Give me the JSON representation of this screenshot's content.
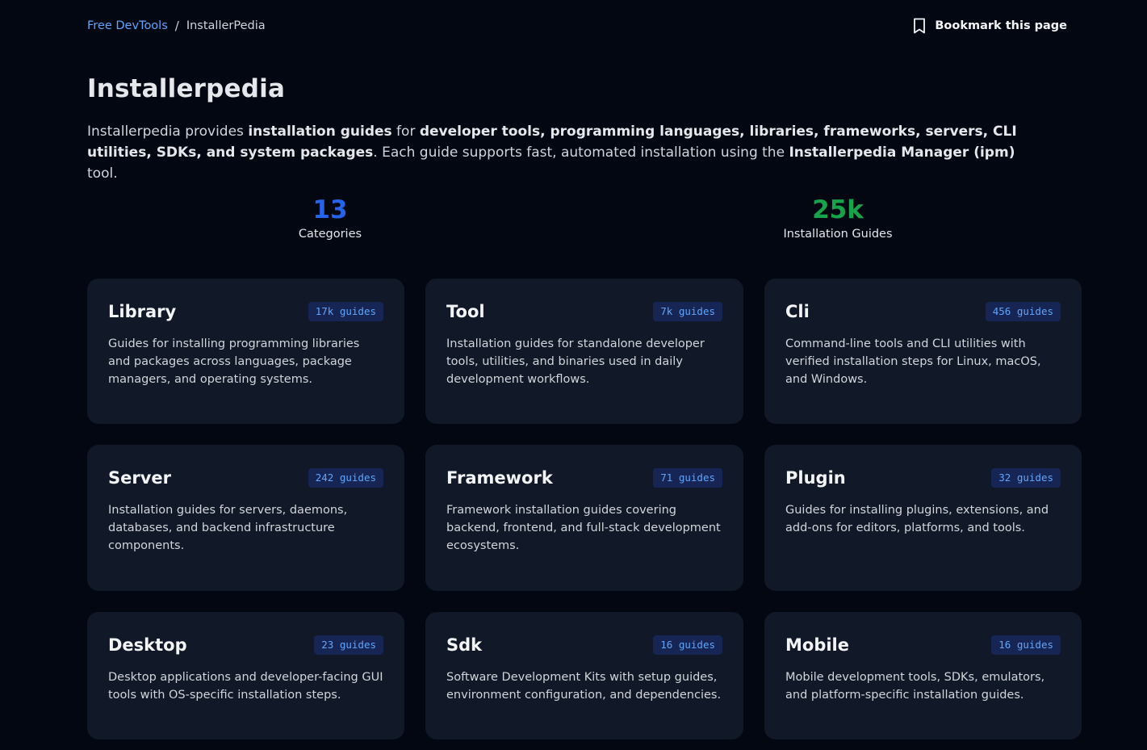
{
  "breadcrumb": {
    "root": "Free DevTools",
    "separator": "/",
    "current": "InstallerPedia"
  },
  "bookmark": {
    "label": "Bookmark this page",
    "icon": "bookmark-icon"
  },
  "title": "Installerpedia",
  "intro": {
    "p1": "Installerpedia provides ",
    "b1": "installation guides",
    "p2": " for ",
    "b2": "developer tools, programming languages, libraries, frameworks, servers, CLI utilities, SDKs, and system packages",
    "p3": ". Each guide supports fast, automated installation using the ",
    "b3": "Installerpedia Manager (ipm)",
    "p4": " tool."
  },
  "stats": {
    "categories": {
      "value": "13",
      "label": "Categories"
    },
    "guides": {
      "value": "25k",
      "label": "Installation Guides"
    }
  },
  "cards": [
    {
      "title": "Library",
      "badge": "17k guides",
      "desc": "Guides for installing programming libraries and packages across languages, package managers, and operating systems."
    },
    {
      "title": "Tool",
      "badge": "7k guides",
      "desc": "Installation guides for standalone developer tools, utilities, and binaries used in daily development workflows."
    },
    {
      "title": "Cli",
      "badge": "456 guides",
      "desc": "Command-line tools and CLI utilities with verified installation steps for Linux, macOS, and Windows."
    },
    {
      "title": "Server",
      "badge": "242 guides",
      "desc": "Installation guides for servers, daemons, databases, and backend infrastructure components."
    },
    {
      "title": "Framework",
      "badge": "71 guides",
      "desc": "Framework installation guides covering backend, frontend, and full-stack development ecosystems."
    },
    {
      "title": "Plugin",
      "badge": "32 guides",
      "desc": "Guides for installing plugins, extensions, and add-ons for editors, platforms, and tools."
    },
    {
      "title": "Desktop",
      "badge": "23 guides",
      "desc": "Desktop applications and developer-facing GUI tools with OS-specific installation steps."
    },
    {
      "title": "Sdk",
      "badge": "16 guides",
      "desc": "Software Development Kits with setup guides, environment configuration, and dependencies."
    },
    {
      "title": "Mobile",
      "badge": "16 guides",
      "desc": "Mobile development tools, SDKs, emulators, and platform-specific installation guides."
    }
  ],
  "colors": {
    "background": "#030712",
    "card": "#111827",
    "accent_blue": "#2563eb",
    "accent_green": "#16a34a",
    "link": "#60a5fa"
  }
}
